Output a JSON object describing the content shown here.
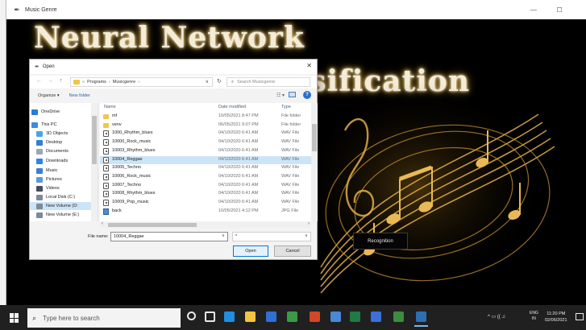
{
  "window": {
    "title": "Music Genre",
    "minimize_glyph": "—",
    "maximize_glyph": "☐"
  },
  "app": {
    "heading_line1": "Neural Network",
    "heading_line2": "ssification",
    "recognition_button": "Recognition"
  },
  "dialog": {
    "title": "Open",
    "close_glyph": "✕",
    "address": {
      "back_glyph": "←",
      "forward_glyph": "→",
      "up_glyph": "↑",
      "crumbs": [
        "Programs",
        "Musicgenre"
      ],
      "separator": "›",
      "lead_glyph": "«",
      "dropdown_glyph": "∨",
      "refresh_glyph": "↻"
    },
    "search_placeholder": "Search Musicgenre",
    "toolbar": {
      "organize": "Organize ▾",
      "new_folder": "New folder"
    },
    "nav_items": [
      {
        "label": "OneDrive",
        "color": "#2b7cd3"
      },
      {
        "label": "This PC",
        "color": "#3a8de0"
      },
      {
        "label": "3D Objects",
        "color": "#4aa3e8"
      },
      {
        "label": "Desktop",
        "color": "#2e7fd6"
      },
      {
        "label": "Documents",
        "color": "#9aa7b5"
      },
      {
        "label": "Downloads",
        "color": "#2f86de"
      },
      {
        "label": "Music",
        "color": "#3b7fd0"
      },
      {
        "label": "Pictures",
        "color": "#5c9ad8"
      },
      {
        "label": "Videos",
        "color": "#444e5c"
      },
      {
        "label": "Local Disk (C:)",
        "color": "#7c8a99"
      },
      {
        "label": "New Volume (D:",
        "color": "#7c8a99"
      },
      {
        "label": "New Volume (E:)",
        "color": "#7c8a99"
      }
    ],
    "columns": {
      "name": "Name",
      "date": "Date modified",
      "type": "Type"
    },
    "files": [
      {
        "name": "mf",
        "date": "10/05/2021 8:47 PM",
        "type": "File folder",
        "icon": "folder"
      },
      {
        "name": "venv",
        "date": "06/05/2021 9:07 PM",
        "type": "File folder",
        "icon": "folder"
      },
      {
        "name": "1000_Rhythm_blues",
        "date": "04/10/2020 6:41 AM",
        "type": "WAV File",
        "icon": "wav"
      },
      {
        "name": "10000_Rock_music",
        "date": "04/10/2020 6:41 AM",
        "type": "WAV File",
        "icon": "wav"
      },
      {
        "name": "10003_Rhythm_blues",
        "date": "04/10/2020 6:41 AM",
        "type": "WAV File",
        "icon": "wav"
      },
      {
        "name": "10004_Reggae",
        "date": "04/10/2020 6:41 AM",
        "type": "WAV File",
        "icon": "wav"
      },
      {
        "name": "10005_Techno",
        "date": "04/10/2020 6:41 AM",
        "type": "WAV File",
        "icon": "wav"
      },
      {
        "name": "10006_Rock_music",
        "date": "04/10/2020 6:41 AM",
        "type": "WAV File",
        "icon": "wav"
      },
      {
        "name": "10007_Techno",
        "date": "04/10/2020 6:41 AM",
        "type": "WAV File",
        "icon": "wav"
      },
      {
        "name": "10008_Rhythm_blues",
        "date": "04/10/2020 6:41 AM",
        "type": "WAV File",
        "icon": "wav"
      },
      {
        "name": "10009_Pop_music",
        "date": "04/10/2020 6:41 AM",
        "type": "WAV File",
        "icon": "wav"
      },
      {
        "name": "back",
        "date": "10/05/2021 4:12 PM",
        "type": "JPG File",
        "icon": "jpg"
      }
    ],
    "selected_file": "10004_Reggae",
    "filename_label": "File name:",
    "filename_value": "10004_Reggae",
    "filetype_value": "*",
    "open_button": "Open",
    "cancel_button": "Cancel"
  },
  "taskbar": {
    "search_placeholder": "Type here to search",
    "apps": [
      {
        "name": "edge",
        "color": "#1f8fe0"
      },
      {
        "name": "file-explorer",
        "color": "#f2c440"
      },
      {
        "name": "mail",
        "color": "#2f6fd6"
      },
      {
        "name": "chrome",
        "color": "#3a9a45"
      },
      {
        "name": "powerpoint",
        "color": "#d24726"
      },
      {
        "name": "calendar",
        "color": "#4a88d9"
      },
      {
        "name": "excel",
        "color": "#1f7a44"
      },
      {
        "name": "photos",
        "color": "#3d6fd8"
      },
      {
        "name": "python",
        "color": "#3c8c3f"
      },
      {
        "name": "idle",
        "color": "#2d6fb4"
      }
    ],
    "tray_icons": "^ ▭ (( ♫",
    "language_line1": "ENG",
    "language_line2": "IN",
    "time": "11:20 PM",
    "date": "02/06/2021"
  }
}
